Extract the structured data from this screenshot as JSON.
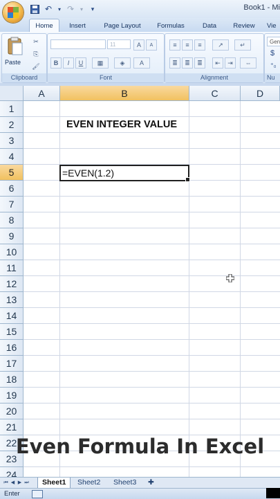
{
  "window": {
    "title": "Book1 - Mi"
  },
  "quick_access": [
    {
      "name": "save-icon",
      "glyph": "💾"
    },
    {
      "name": "undo-icon",
      "glyph": "↶"
    },
    {
      "name": "redo-icon",
      "glyph": "↷"
    },
    {
      "name": "customize-icon",
      "glyph": "▾"
    }
  ],
  "ribbon_tabs": [
    "Home",
    "Insert",
    "Page Layout",
    "Formulas",
    "Data",
    "Review",
    "Vie"
  ],
  "ribbon": {
    "paste_label": "Paste",
    "font_size": "11",
    "groups": {
      "clipboard": "Clipboard",
      "font": "Font",
      "alignment": "Alignment",
      "number": "Nu"
    },
    "number_format": "Gen",
    "currency_symbol": "$",
    "bold": "B",
    "italic": "I",
    "underline": "U",
    "grow_font": "A",
    "font_color": "A"
  },
  "columns": [
    "A",
    "B",
    "C",
    "D"
  ],
  "rows": [
    "1",
    "2",
    "3",
    "4",
    "5",
    "6",
    "7",
    "8",
    "9",
    "10",
    "11",
    "12",
    "13",
    "14",
    "15",
    "16",
    "17",
    "18",
    "19",
    "20",
    "21",
    "22",
    "23",
    "24"
  ],
  "cells": {
    "B2": "EVEN INTEGER VALUE",
    "B5": "=EVEN(1.2)"
  },
  "selection": {
    "column": "B",
    "row": "5"
  },
  "caption": "Even Formula In Excel",
  "sheets": [
    "Sheet1",
    "Sheet2",
    "Sheet3"
  ],
  "active_sheet": "Sheet1",
  "status": {
    "mode": "Enter"
  },
  "colors": {
    "selected_header": "#f1c15f",
    "gridline": "#d0d7e5",
    "ribbon": "#dce8f7"
  }
}
